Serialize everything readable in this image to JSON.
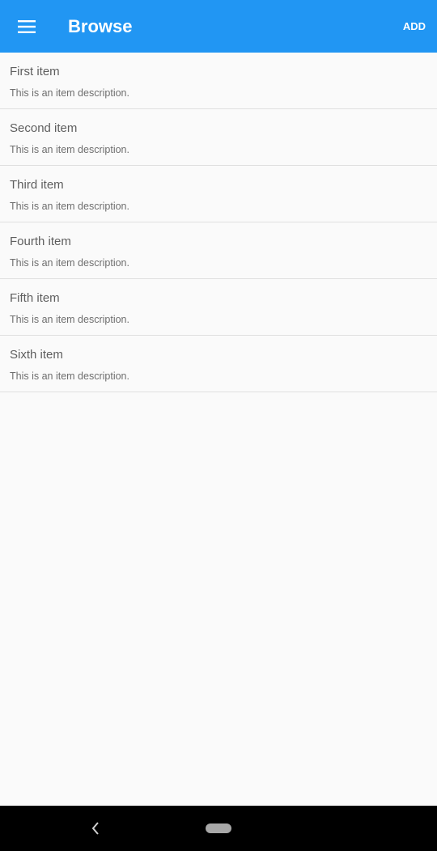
{
  "appbar": {
    "title": "Browse",
    "add_label": "ADD",
    "color": "#2196f3",
    "menu_icon": "hamburger-menu-icon"
  },
  "items": [
    {
      "title": "First item",
      "description": "This is an item description."
    },
    {
      "title": "Second item",
      "description": "This is an item description."
    },
    {
      "title": "Third item",
      "description": "This is an item description."
    },
    {
      "title": "Fourth item",
      "description": "This is an item description."
    },
    {
      "title": "Fifth item",
      "description": "This is an item description."
    },
    {
      "title": "Sixth item",
      "description": "This is an item description."
    }
  ],
  "navbar": {
    "back_icon": "back-chevron-icon",
    "home_icon": "home-pill-icon"
  }
}
